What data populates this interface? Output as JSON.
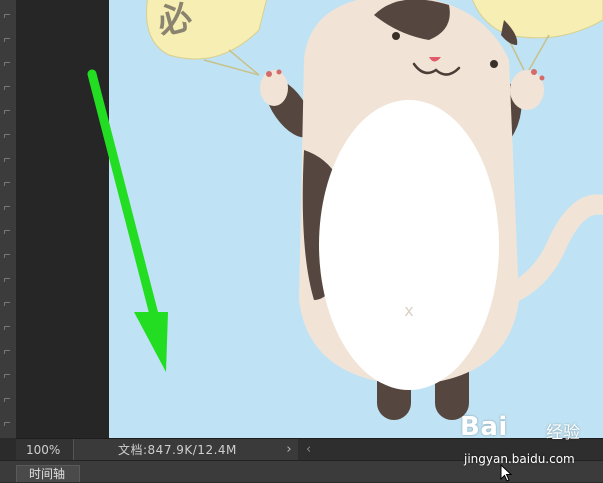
{
  "status_bar": {
    "zoom": "100%",
    "doc_info": "文档:847.9K/12.4M",
    "expand_arrow": "›",
    "scroll_left": "‹"
  },
  "panel": {
    "timeline_tab": "时间轴"
  },
  "artwork": {
    "fan_left_text": "必"
  },
  "watermark": {
    "logo": "Bai",
    "logo_suffix": "经验",
    "url": "jingyan.baidu.com"
  },
  "colors": {
    "document_bg": "#bfe3f4",
    "cat_body": "#f1e4d6",
    "cat_belly": "#ffffff",
    "cat_spots": "#55473f",
    "fan": "#f6eeb2",
    "annotation_arrow": "#22dd22"
  },
  "icons": [
    "left-toolbar-tick-icon",
    "green-annotation-arrow",
    "chevron-right-icon",
    "chevron-left-icon",
    "mouse-cursor-icon"
  ]
}
